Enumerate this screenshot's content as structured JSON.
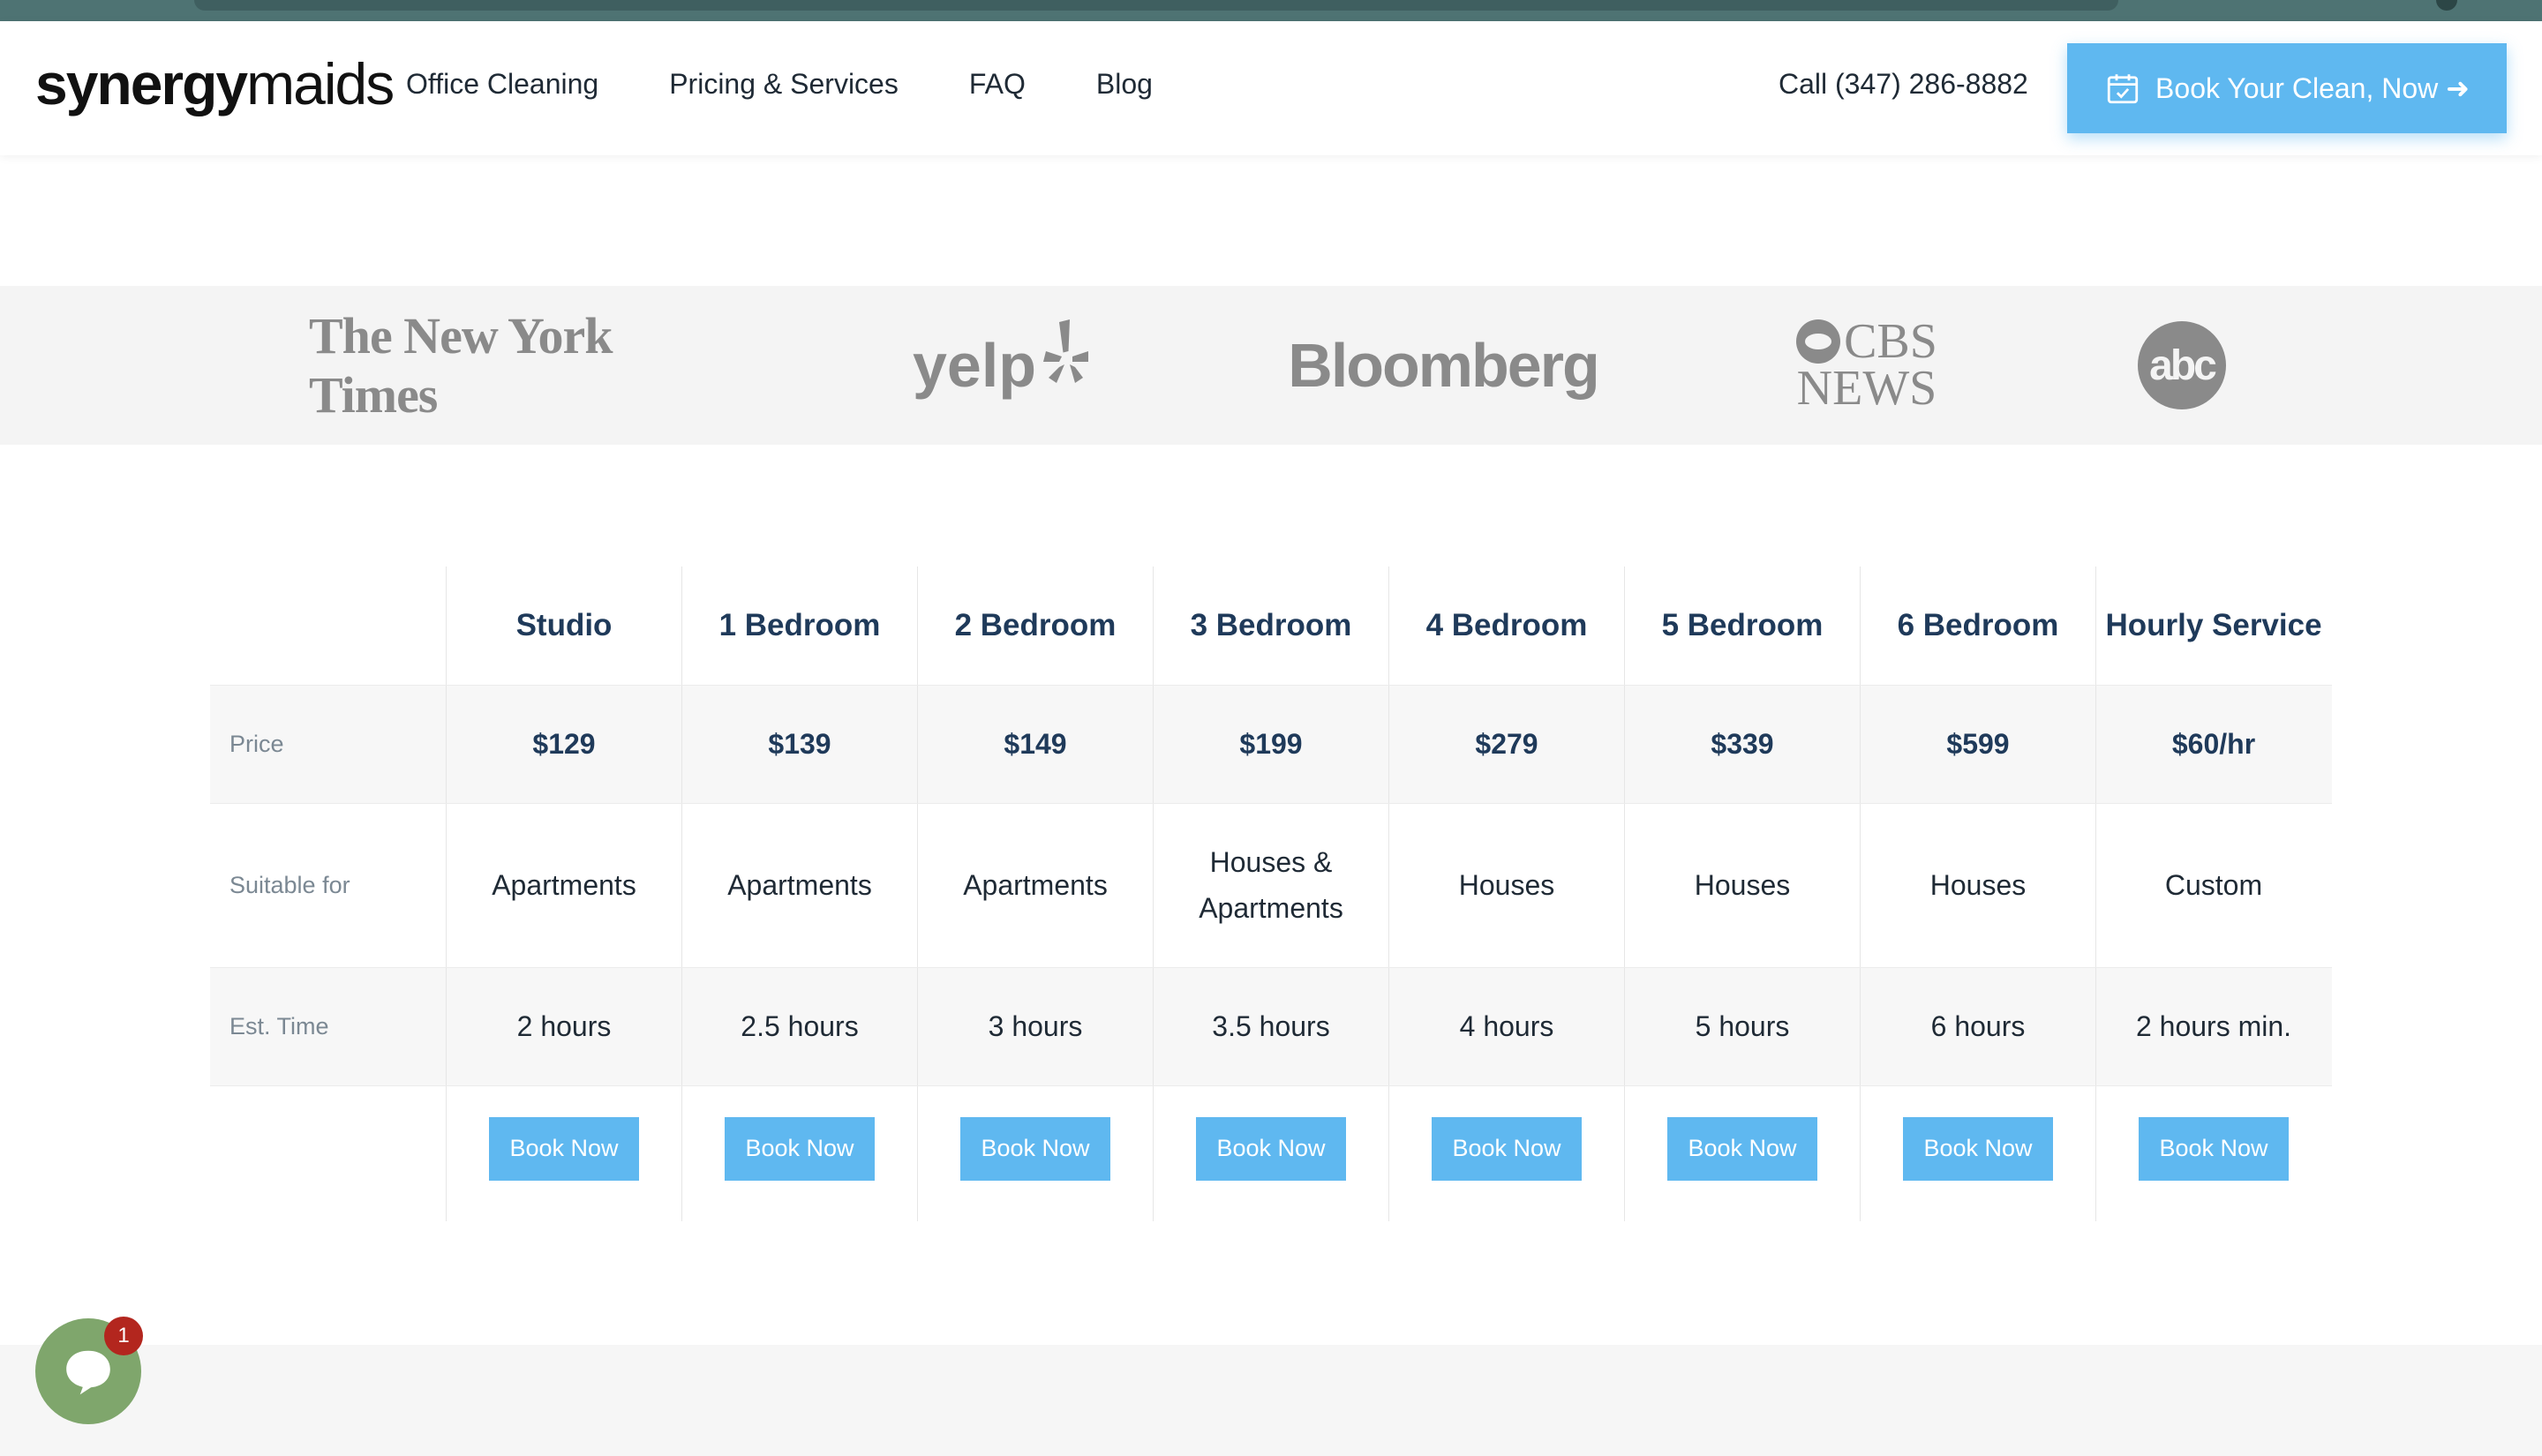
{
  "header": {
    "logo_bold": "synergy",
    "logo_light": "maids",
    "nav": [
      "Office Cleaning",
      "Pricing & Services",
      "FAQ",
      "Blog"
    ],
    "phone": "Call (347) 286-8882",
    "cta": "Book Your Clean, Now ➜"
  },
  "press": {
    "nyt": "The New York Times",
    "yelp": "yelp",
    "bloomberg": "Bloomberg",
    "cbs_line1": "CBS",
    "cbs_line2": "NEWS",
    "abc": "abc"
  },
  "pricing": {
    "columns": [
      "Studio",
      "1 Bedroom",
      "2 Bedroom",
      "3 Bedroom",
      "4 Bedroom",
      "5 Bedroom",
      "6 Bedroom",
      "Hourly Service"
    ],
    "row_labels": {
      "price": "Price",
      "suitable": "Suitable for",
      "time": "Est. Time"
    },
    "prices": [
      "$129",
      "$139",
      "$149",
      "$199",
      "$279",
      "$339",
      "$599",
      "$60/hr"
    ],
    "suitable": [
      "Apartments",
      "Apartments",
      "Apartments",
      "Houses & Apartments",
      "Houses",
      "Houses",
      "Houses",
      "Custom"
    ],
    "times": [
      "2 hours",
      "2.5 hours",
      "3 hours",
      "3.5 hours",
      "4 hours",
      "5 hours",
      "6 hours",
      "2 hours min."
    ],
    "book_label": "Book Now"
  },
  "chat": {
    "badge": "1",
    "icon": "chat-bubble-icon"
  },
  "colors": {
    "accent": "#5fb8f0",
    "heading": "#1f3a5a",
    "chat": "#7fa66c",
    "badge": "#b3261e"
  }
}
